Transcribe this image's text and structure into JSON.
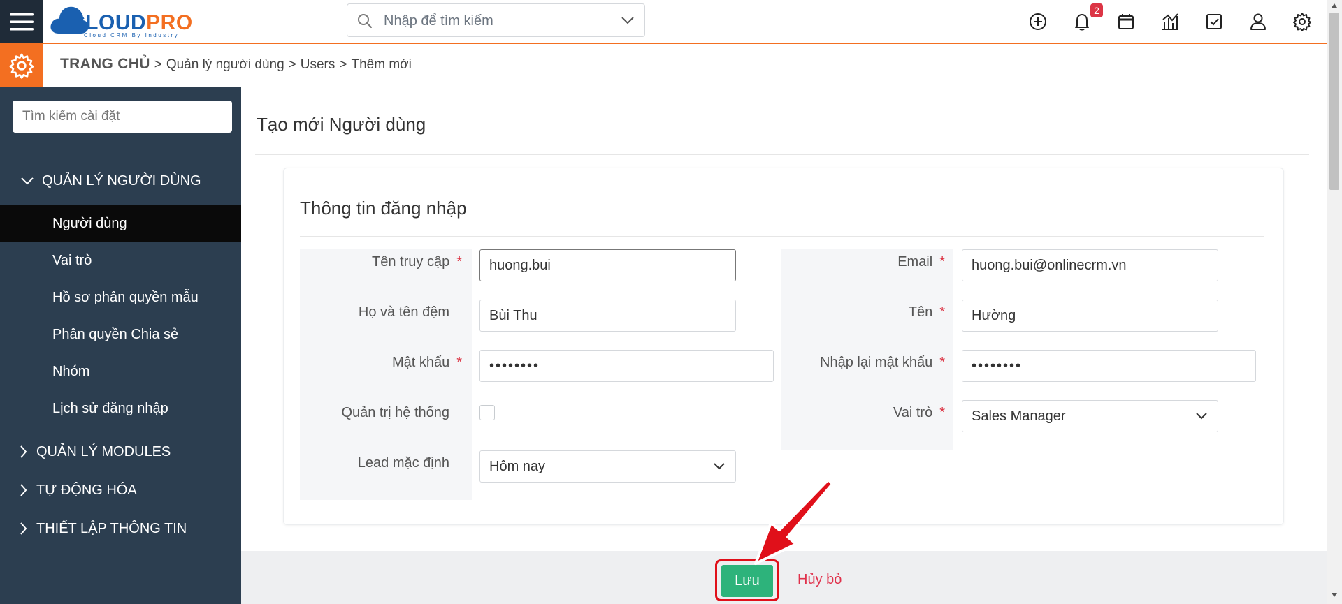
{
  "topbar": {
    "logo_main": "CLOUD",
    "logo_accent": "PRO",
    "logo_sub": "Cloud CRM By Industry",
    "search_placeholder": "Nhập để tìm kiếm",
    "notification_count": "2"
  },
  "breadcrumb": {
    "home": "TRANG CHỦ",
    "items": [
      "Quản lý người dùng",
      "Users",
      "Thêm mới"
    ]
  },
  "sidebar": {
    "search_placeholder": "Tìm kiếm cài đặt",
    "sections": [
      {
        "label": "QUẢN LÝ NGƯỜI DÙNG",
        "expanded": true
      },
      {
        "label": "QUẢN LÝ MODULES",
        "expanded": false
      },
      {
        "label": "TỰ ĐỘNG HÓA",
        "expanded": false
      },
      {
        "label": "THIẾT LẬP THÔNG TIN",
        "expanded": false
      }
    ],
    "items": [
      "Người dùng",
      "Vai trò",
      "Hồ sơ phân quyền mẫu",
      "Phân quyền Chia sẻ",
      "Nhóm",
      "Lịch sử đăng nhập"
    ],
    "active_item": "Người dùng"
  },
  "main": {
    "page_title": "Tạo mới Người dùng",
    "card_title": "Thông tin đăng nhập",
    "fields": {
      "username": {
        "label": "Tên truy cập",
        "value": "huong.bui"
      },
      "middle_name": {
        "label": "Họ và tên đệm",
        "value": "Bùi Thu"
      },
      "password": {
        "label": "Mật khẩu",
        "value": "••••••••"
      },
      "admin": {
        "label": "Quản trị hệ thống",
        "checked": false
      },
      "lead": {
        "label": "Lead mặc định",
        "value": "Hôm nay"
      },
      "email": {
        "label": "Email",
        "value": "huong.bui@onlinecrm.vn"
      },
      "first_name": {
        "label": "Tên",
        "value": "Hường"
      },
      "confirm_password": {
        "label": "Nhập lại mật khẩu",
        "value": "••••••••"
      },
      "role": {
        "label": "Vai trò",
        "value": "Sales Manager"
      }
    },
    "required_mark": "*"
  },
  "footer": {
    "save_label": "Lưu",
    "cancel_label": "Hủy bỏ"
  },
  "colors": {
    "brand_orange": "#f36f21",
    "brand_blue": "#1a60b0",
    "sidebar_bg": "#2c3e50",
    "save_green": "#2db37b",
    "highlight_red": "#e0101a"
  }
}
